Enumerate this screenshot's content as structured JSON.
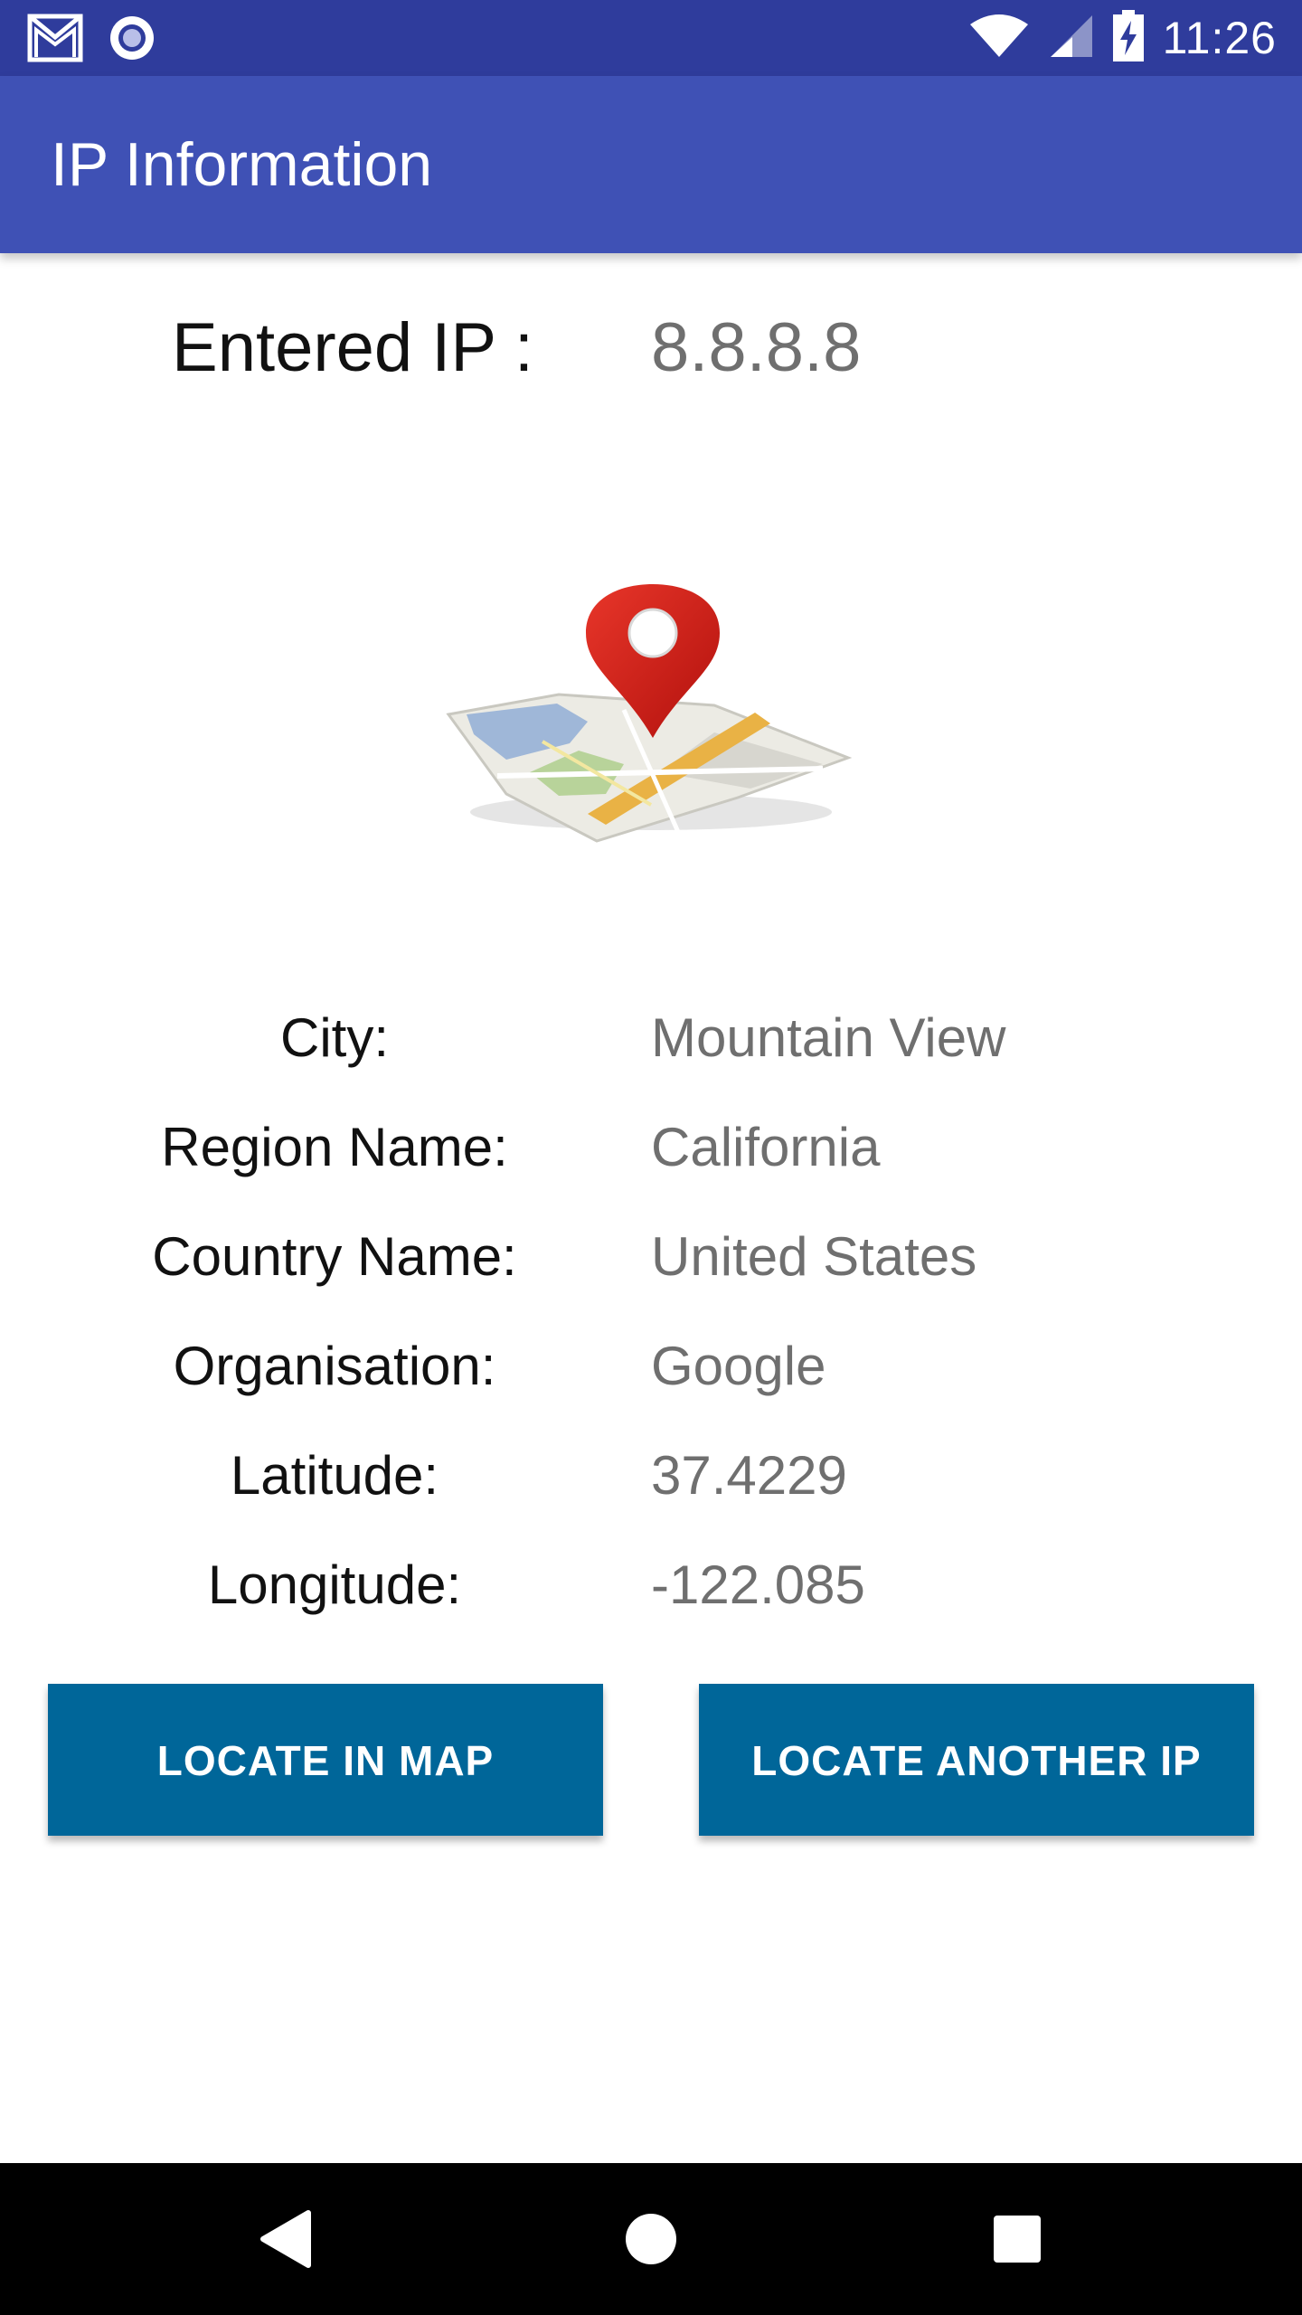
{
  "status_bar": {
    "time": "11:26",
    "left_icons": [
      "gmail-icon",
      "radio-icon"
    ],
    "right_icons": [
      "wifi-icon",
      "cell-signal-icon",
      "battery-charging-icon"
    ],
    "background_color": "#2f3c9c"
  },
  "app_bar": {
    "title": "IP Information",
    "background_color": "#3f51b5"
  },
  "ip": {
    "label": "Entered IP :",
    "value": "8.8.8.8"
  },
  "map_icon": "map-pin-icon",
  "info": [
    {
      "label": "City:",
      "value": "Mountain View"
    },
    {
      "label": "Region Name:",
      "value": "California"
    },
    {
      "label": "Country Name:",
      "value": "United States"
    },
    {
      "label": "Organisation:",
      "value": "Google"
    },
    {
      "label": "Latitude:",
      "value": "37.4229"
    },
    {
      "label": "Longitude:",
      "value": "-122.085"
    }
  ],
  "buttons": {
    "locate_in_map": "LOCATE IN MAP",
    "locate_another": "LOCATE ANOTHER IP",
    "color": "#006699"
  },
  "nav_bar": {
    "icons": [
      "back-icon",
      "home-icon",
      "recents-icon"
    ]
  }
}
